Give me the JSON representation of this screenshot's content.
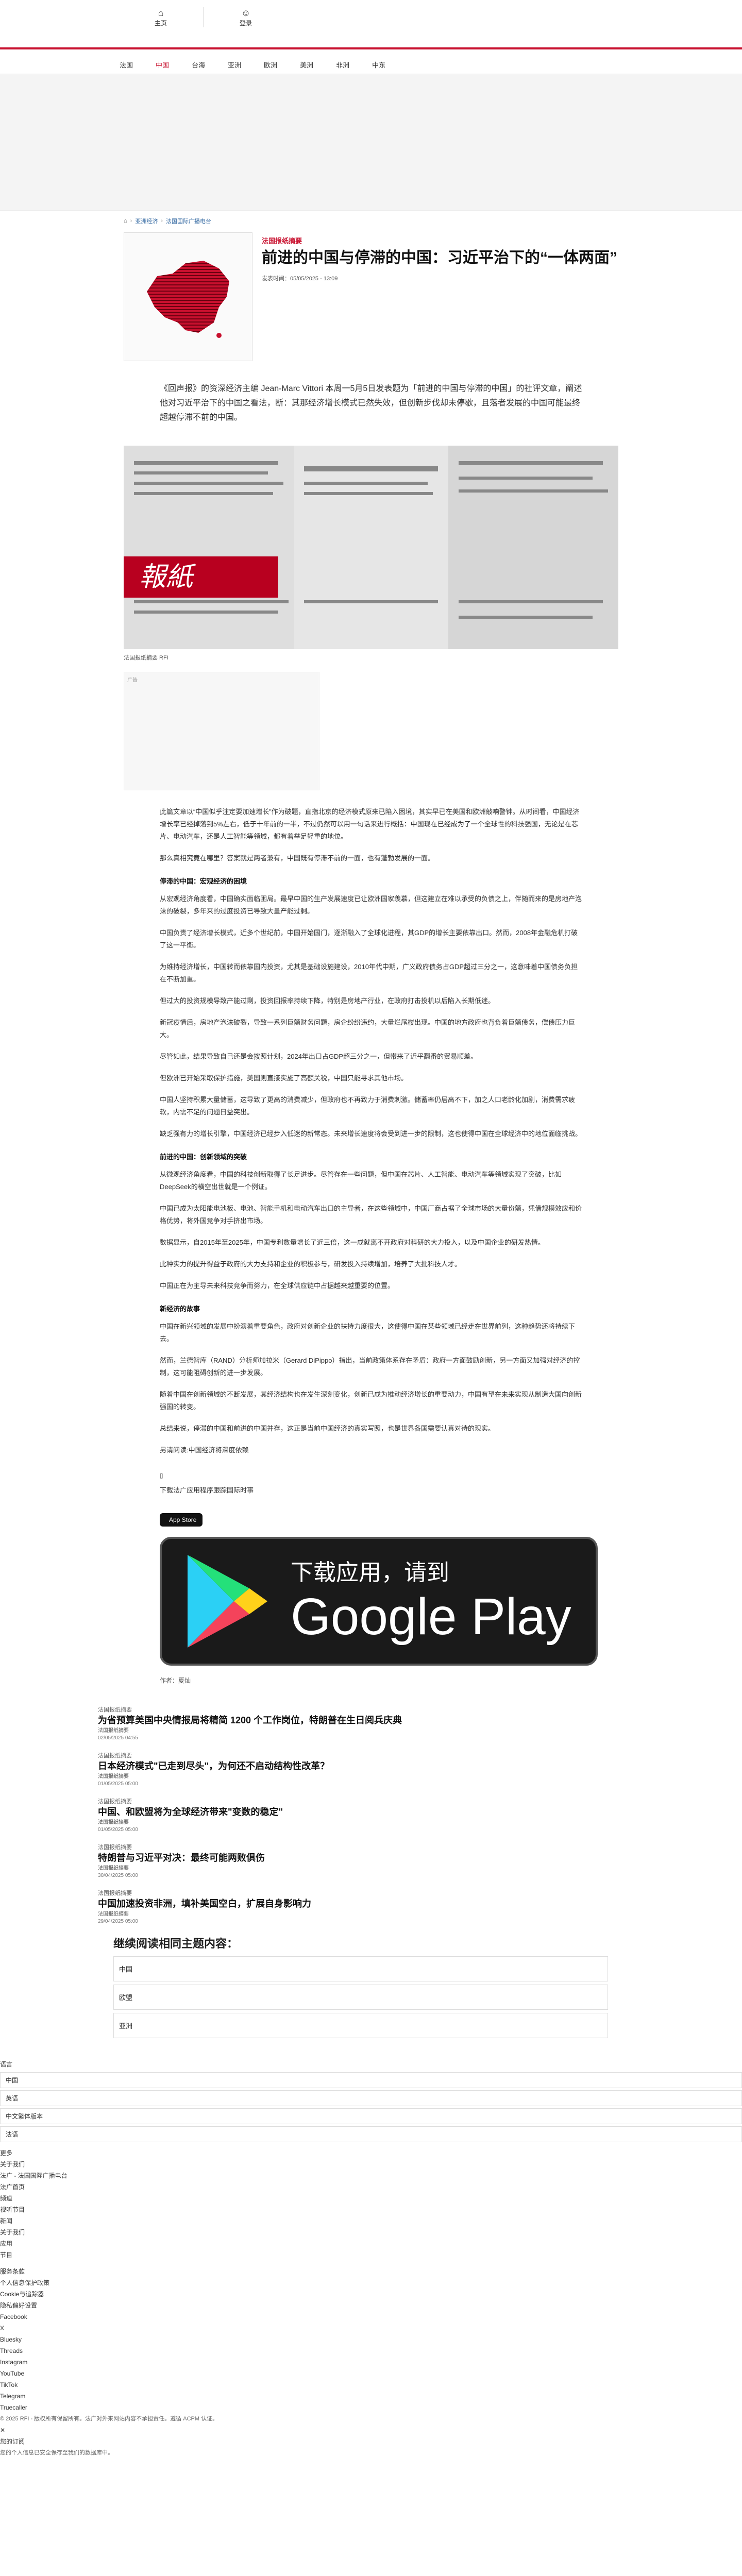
{
  "header": {
    "icons": [
      {
        "label": "主页",
        "icon": "home-icon"
      },
      {
        "label": "登录",
        "icon": "user-icon"
      }
    ]
  },
  "nav": [
    "法国",
    "中国",
    "台海",
    "亚洲",
    "欧洲",
    "美洲",
    "非洲",
    "中东"
  ],
  "breadcrumb": {
    "home": "",
    "category": "亚洲经济",
    "current": "法国国际广播电台"
  },
  "article": {
    "kicker": "法国报纸摘要",
    "title": "前进的中国与停滞的中国：习近平治下的“一体两面”",
    "date": "发表时间：05/05/2025 - 13:09",
    "lead": "《回声报》的资深经济主编 Jean-Marc Vittori 本周一5月5日发表题为「前进的中国与停滞的中国」的社评文章，阐述他对习近平治下的中国之看法，断：其那经济增长模式已然失效，但创新步伐却未停歇，且落者发展的中国可能最终超越停滞不前的中国。",
    "hero_caption": "法国报纸摘要 RFI",
    "ad_label": "广告",
    "paragraphs": [
      "此篇文章以“中国似乎注定要加速增长”作为破题，直指北京的经济模式原来已陷入困境，其实早已在美国和欧洲敲响警钟。从时间看，中国经济增长率已经掉落到5%左右，低于十年前的一半，不过仍然可以用一句话来进行概括：中国现在已经成为了一个全球性的科技强国，无论是在芯片、电动汽车，还是人工智能等领域，都有着举足轻重的地位。",
      "那么真相究竟在哪里？答案就是两者兼有，中国既有停滞不前的一面，也有蓬勃发展的一面。",
      "停滞的中国：宏观经济的困境",
      "从宏观经济角度看，中国确实面临困局。最早中国的生产发展速度已让欧洲国家羡慕，但这建立在难以承受的负债之上，伴随而来的是房地产泡沫的破裂，多年来的过度投资已导致大量产能过剩。",
      "中国负责了经济增长模式，近多个世纪前，中国开始国门，逐渐融入了全球化进程，其GDP的增长主要依靠出口。然而，2008年金融危机打破了这一平衡。",
      "为维持经济增长，中国转而依靠国内投资，尤其是基础设施建设，2010年代中期，广义政府债务占GDP超过三分之一，这意味着中国债务负担在不断加重。",
      "但过大的投资规模导致产能过剩，投资回报率持续下降，特别是房地产行业，在政府打击投机以后陷入长期低迷。",
      "新冠疫情后，房地产泡沫破裂，导致一系列巨额财务问题，房企纷纷违约，大量烂尾楼出现。中国的地方政府也背负着巨额债务，偿债压力巨大。",
      "尽管如此，结果导致自己还是会按照计划，2024年出口占GDP超三分之一，但带来了近乎翻番的贸易顺差。",
      "但欧洲已开始采取保护措施，美国则直接实施了高额关税，中国只能寻求其他市场。",
      "中国人坚持积累大量储蓄，这导致了更高的消费减少，但政府也不再致力于消费刺激。储蓄率仍居高不下，加之人口老龄化加剧，消费需求疲软，内需不足的问题日益突出。",
      "缺乏强有力的增长引擎，中国经济已经步入低迷的新常态。未来增长速度将会受到进一步的限制，这也使得中国在全球经济中的地位面临挑战。",
      "前进的中国：创新领域的突破",
      "从微观经济角度看，中国的科技创新取得了长足进步。尽管存在一些问题，但中国在芯片、人工智能、电动汽车等领域实现了突破，比如DeepSeek的横空出世就是一个例证。",
      "中国已成为太阳能电池板、电池、智能手机和电动汽车出口的主导者，在这些领域中，中国厂商占据了全球市场的大量份额，凭借规模效应和价格优势，将外国竞争对手挤出市场。",
      "数据显示，自2015年至2025年，中国专利数量增长了近三倍，这一成就离不开政府对科研的大力投入，以及中国企业的研发热情。",
      "此种实力的提升得益于政府的大力支持和企业的积极参与，研发投入持续增加，培养了大批科技人才。",
      "中国正在为主导未来科技竞争而努力，在全球供应链中占据越来越重要的位置。",
      "新经济的故事",
      "中国在新兴领域的发展中扮演着重要角色，政府对创新企业的扶持力度很大，这使得中国在某些领域已经走在世界前列，这种趋势还将持续下去。",
      "然而，兰德智库（RAND）分析师加拉米（Gerard DiPippo）指出，当前政策体系存在矛盾：政府一方面鼓励创新，另一方面又加强对经济的控制，这可能阻碍创新的进一步发展。",
      "随着中国在创新领域的不断发展，其经济结构也在发生深刻变化，创新已成为推动经济增长的重要动力，中国有望在未来实现从制造大国向创新强国的转变。",
      "总结来说，停滞的中国和前进的中国并存，这正是当前中国经济的真实写照，也是世界各国需要认真对待的现实。"
    ],
    "also_read": "另请阅读:中国经济将深度依赖",
    "app_label": "下载法广应用程序跟踪国际时事",
    "app_store": "App Store",
    "gplay_line1": "下载应用，请到",
    "gplay_line2": "Google Play",
    "translator": "作者：夏灿"
  },
  "related": [
    {
      "tag": "法国报纸摘要",
      "title": "为省预算美国中央情报局将精简 1200 个工作岗位，特朗普在生日阅兵庆典",
      "summary": "法国报纸摘要",
      "date": "02/05/2025 04:55"
    },
    {
      "tag": "法国报纸摘要",
      "title": "日本经济模式\"已走到尽头\"，为何还不启动结构性改革？",
      "summary": "法国报纸摘要",
      "date": "01/05/2025 05:00"
    },
    {
      "tag": "法国报纸摘要",
      "title": "中国、和欧盟将为全球经济带来\"变数的稳定\"",
      "summary": "法国报纸摘要",
      "date": "01/05/2025 05:00"
    },
    {
      "tag": "法国报纸摘要",
      "title": "特朗普与习近平对决：最终可能两败俱伤",
      "summary": "法国报纸摘要",
      "date": "30/04/2025 05:00"
    },
    {
      "tag": "法国报纸摘要",
      "title": "中国加速投资非洲，填补美国空白，扩展自身影响力",
      "summary": "法国报纸摘要",
      "date": "29/04/2025 05:00"
    }
  ],
  "readmore": {
    "heading": "继续阅读相同主题内容：",
    "items": [
      "中国",
      "欧盟",
      "亚洲"
    ]
  },
  "footer": {
    "lang_label": "语言",
    "languages": [
      "中国",
      "英语",
      "中文繁体版本",
      "法语"
    ],
    "more": "更多",
    "about": "关于我们",
    "links": [
      "法广 - 法国国际广播电台",
      "法广首页",
      "频道",
      "视听节目",
      "新闻",
      "关于我们",
      "应用",
      "节目"
    ],
    "social": [
      "Facebook",
      "X",
      "Bluesky",
      "Threads",
      "Instagram",
      "YouTube",
      "TikTok",
      "Telegram",
      "Truecaller"
    ],
    "legal": [
      "服务条款",
      "个人信息保护政策",
      "Cookie与追踪器",
      "隐私偏好设置"
    ],
    "copyright": "© 2025 RFI - 版权所有保留所有。法广对外来网站内容不承担责任。遵循 ACPM 认证。",
    "close": "✕",
    "subscribe": "您的订阅",
    "note": "您的个人信息已安全保存至我们的数据库中。"
  }
}
